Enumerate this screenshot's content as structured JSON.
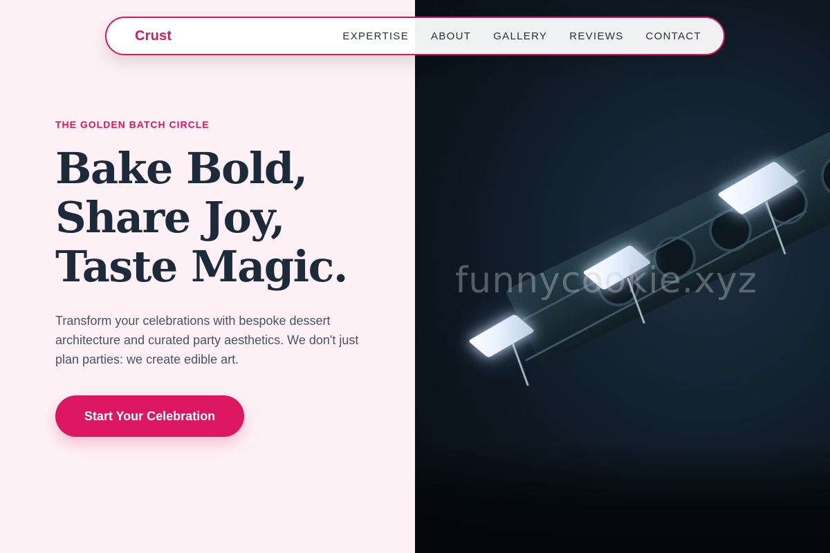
{
  "nav": {
    "brand": "Crust",
    "links": [
      "EXPERTISE",
      "ABOUT",
      "GALLERY",
      "REVIEWS",
      "CONTACT"
    ]
  },
  "hero": {
    "eyebrow": "THE GOLDEN BATCH CIRCLE",
    "headline_lines": [
      "Bake Bold,",
      "Share Joy,",
      "Taste Magic."
    ],
    "lead": "Transform your celebrations with bespoke dessert architecture and curated party aesthetics. We don't just plan parties: we create edible art.",
    "cta_label": "Start Your Celebration"
  },
  "image": {
    "watermark": "funnycookie.xyz"
  },
  "colors": {
    "accent": "#d6185e",
    "cta": "#dc1760",
    "heading": "#1d2a3a",
    "body_text": "#4a5262",
    "left_background": "#fdf1f5"
  }
}
